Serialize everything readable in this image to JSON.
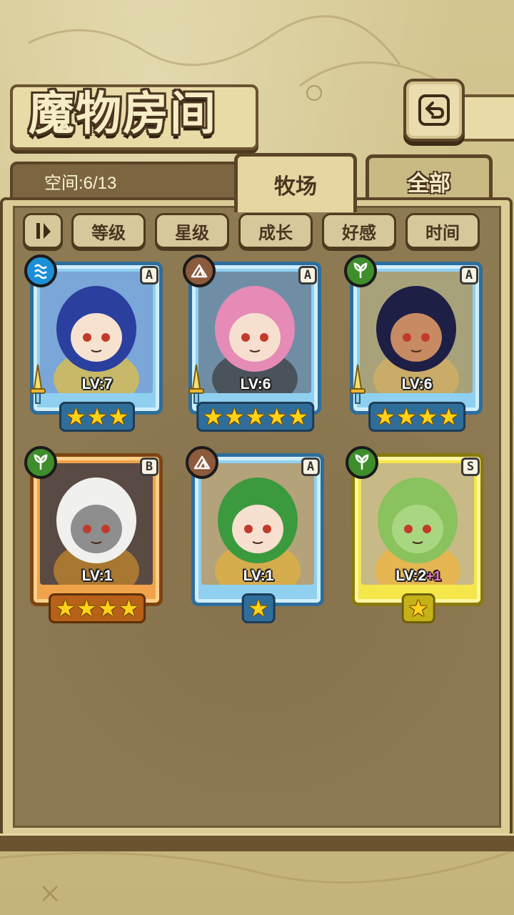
{
  "header": {
    "title": "魔物房间",
    "back_icon": "back-arrow-icon"
  },
  "tabs": [
    {
      "label": "牧场",
      "active": true
    },
    {
      "label": "全部",
      "active": false
    }
  ],
  "space": {
    "text": "空间:6/13"
  },
  "sort_buttons": [
    "等级",
    "星级",
    "成长",
    "好感",
    "时间"
  ],
  "monsters": [
    {
      "rank": "A",
      "element": "water",
      "level_text": "LV:7",
      "bonus": "",
      "stars": 3,
      "weapon": true,
      "frame": "blue"
    },
    {
      "rank": "A",
      "element": "earth",
      "level_text": "LV:6",
      "bonus": "",
      "stars": 5,
      "weapon": true,
      "frame": "blue"
    },
    {
      "rank": "A",
      "element": "grass",
      "level_text": "LV:6",
      "bonus": "",
      "stars": 4,
      "weapon": true,
      "frame": "blue"
    },
    {
      "rank": "B",
      "element": "grass",
      "level_text": "LV:1",
      "bonus": "",
      "stars": 4,
      "weapon": false,
      "frame": "orange"
    },
    {
      "rank": "A",
      "element": "earth",
      "level_text": "LV:1",
      "bonus": "",
      "stars": 1,
      "weapon": false,
      "frame": "blue"
    },
    {
      "rank": "S",
      "element": "grass",
      "level_text": "LV:2",
      "bonus": "+1",
      "stars": 1,
      "weapon": false,
      "frame": "yellow"
    }
  ]
}
